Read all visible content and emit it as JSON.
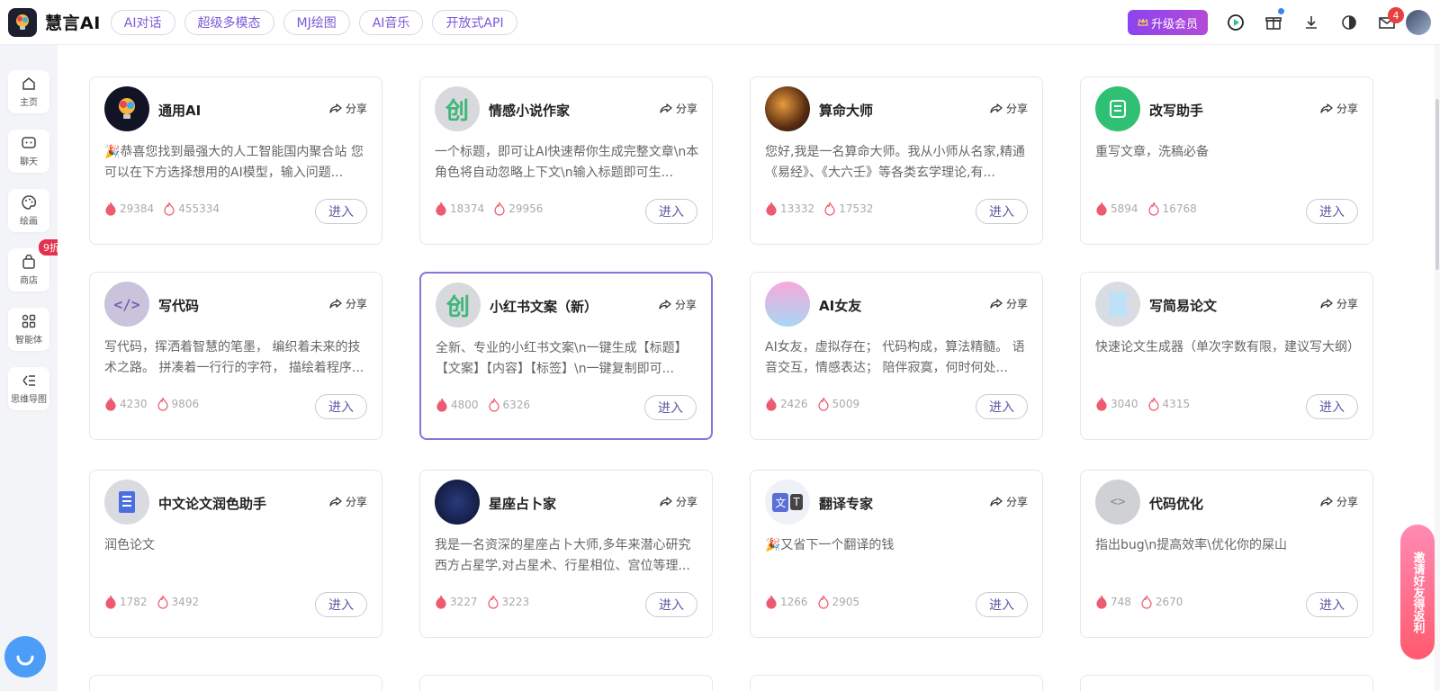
{
  "header": {
    "app_title": "慧言AI",
    "tabs": [
      "AI对话",
      "超级多模态",
      "MJ绘图",
      "AI音乐",
      "开放式API"
    ],
    "upgrade_label": "升级会员",
    "mail_count": "4"
  },
  "sidebar": {
    "items": [
      {
        "label": "主页",
        "icon": "home-icon"
      },
      {
        "label": "聊天",
        "icon": "chat-icon"
      },
      {
        "label": "绘画",
        "icon": "palette-icon"
      },
      {
        "label": "商店",
        "icon": "bag-icon",
        "badge": "9折"
      },
      {
        "label": "智能体",
        "icon": "apps-icon"
      },
      {
        "label": "思维导图",
        "icon": "mindmap-icon"
      }
    ]
  },
  "share_label": "分享",
  "enter_label": "进入",
  "cards": [
    {
      "title": "通用AI",
      "desc": "🎉恭喜您找到最强大的人工智能国内聚合站 您可以在下方选择想用的AI模型，输入问题...",
      "hot": "29384",
      "uses": "455334",
      "avatar": "bulb"
    },
    {
      "title": "情感小说作家",
      "desc": "一个标题，即可让AI快速帮你生成完整文章\\n本角色将自动忽略上下文\\n输入标题即可生...",
      "hot": "18374",
      "uses": "29956",
      "avatar": "chuang"
    },
    {
      "title": "算命大师",
      "desc": "您好,我是一名算命大师。我从小师从名家,精通《易经》、《大六壬》等各类玄学理论,有...",
      "hot": "13332",
      "uses": "17532",
      "avatar": "taiji"
    },
    {
      "title": "改写助手",
      "desc": "重写文章，洗稿必备",
      "hot": "5894",
      "uses": "16768",
      "avatar": "rewrite"
    },
    {
      "title": "写代码",
      "desc": "写代码，挥洒着智慧的笔墨， 编织着未来的技术之路。 拼凑着一行行的字符， 描绘着程序...",
      "hot": "4230",
      "uses": "9806",
      "avatar": "code"
    },
    {
      "title": "小红书文案（新）",
      "desc": "全新、专业的小红书文案\\n一键生成【标题】【文案】【内容】【标签】\\n一键复制即可...",
      "hot": "4800",
      "uses": "6326",
      "avatar": "chuang",
      "active": true
    },
    {
      "title": "AI女友",
      "desc": "AI女友，虚拟存在； 代码构成，算法精髓。 语音交互，情感表达； 陪伴寂寞，何时何处...",
      "hot": "2426",
      "uses": "5009",
      "avatar": "girl"
    },
    {
      "title": "写简易论文",
      "desc": "快速论文生成器（单次字数有限，建议写大纲）",
      "hot": "3040",
      "uses": "4315",
      "avatar": "paper"
    },
    {
      "title": "中文论文润色助手",
      "desc": "润色论文",
      "hot": "1782",
      "uses": "3492",
      "avatar": "doc"
    },
    {
      "title": "星座占卜家",
      "desc": "我是一名资深的星座占卜大师,多年来潜心研究西方占星学,对占星术、行星相位、宫位等理...",
      "hot": "3227",
      "uses": "3223",
      "avatar": "star"
    },
    {
      "title": "翻译专家",
      "desc": "🎉又省下一个翻译的钱",
      "hot": "1266",
      "uses": "2905",
      "avatar": "translate"
    },
    {
      "title": "代码优化",
      "desc": "指出bug\\n提高效率\\优化你的屎山",
      "hot": "748",
      "uses": "2670",
      "avatar": "codeopt"
    }
  ],
  "promo_text": "邀请好友得返利",
  "colors": {
    "accent": "#7a5ad6",
    "upgrade": "#8b44f0",
    "hot": "#ec5b6f"
  }
}
